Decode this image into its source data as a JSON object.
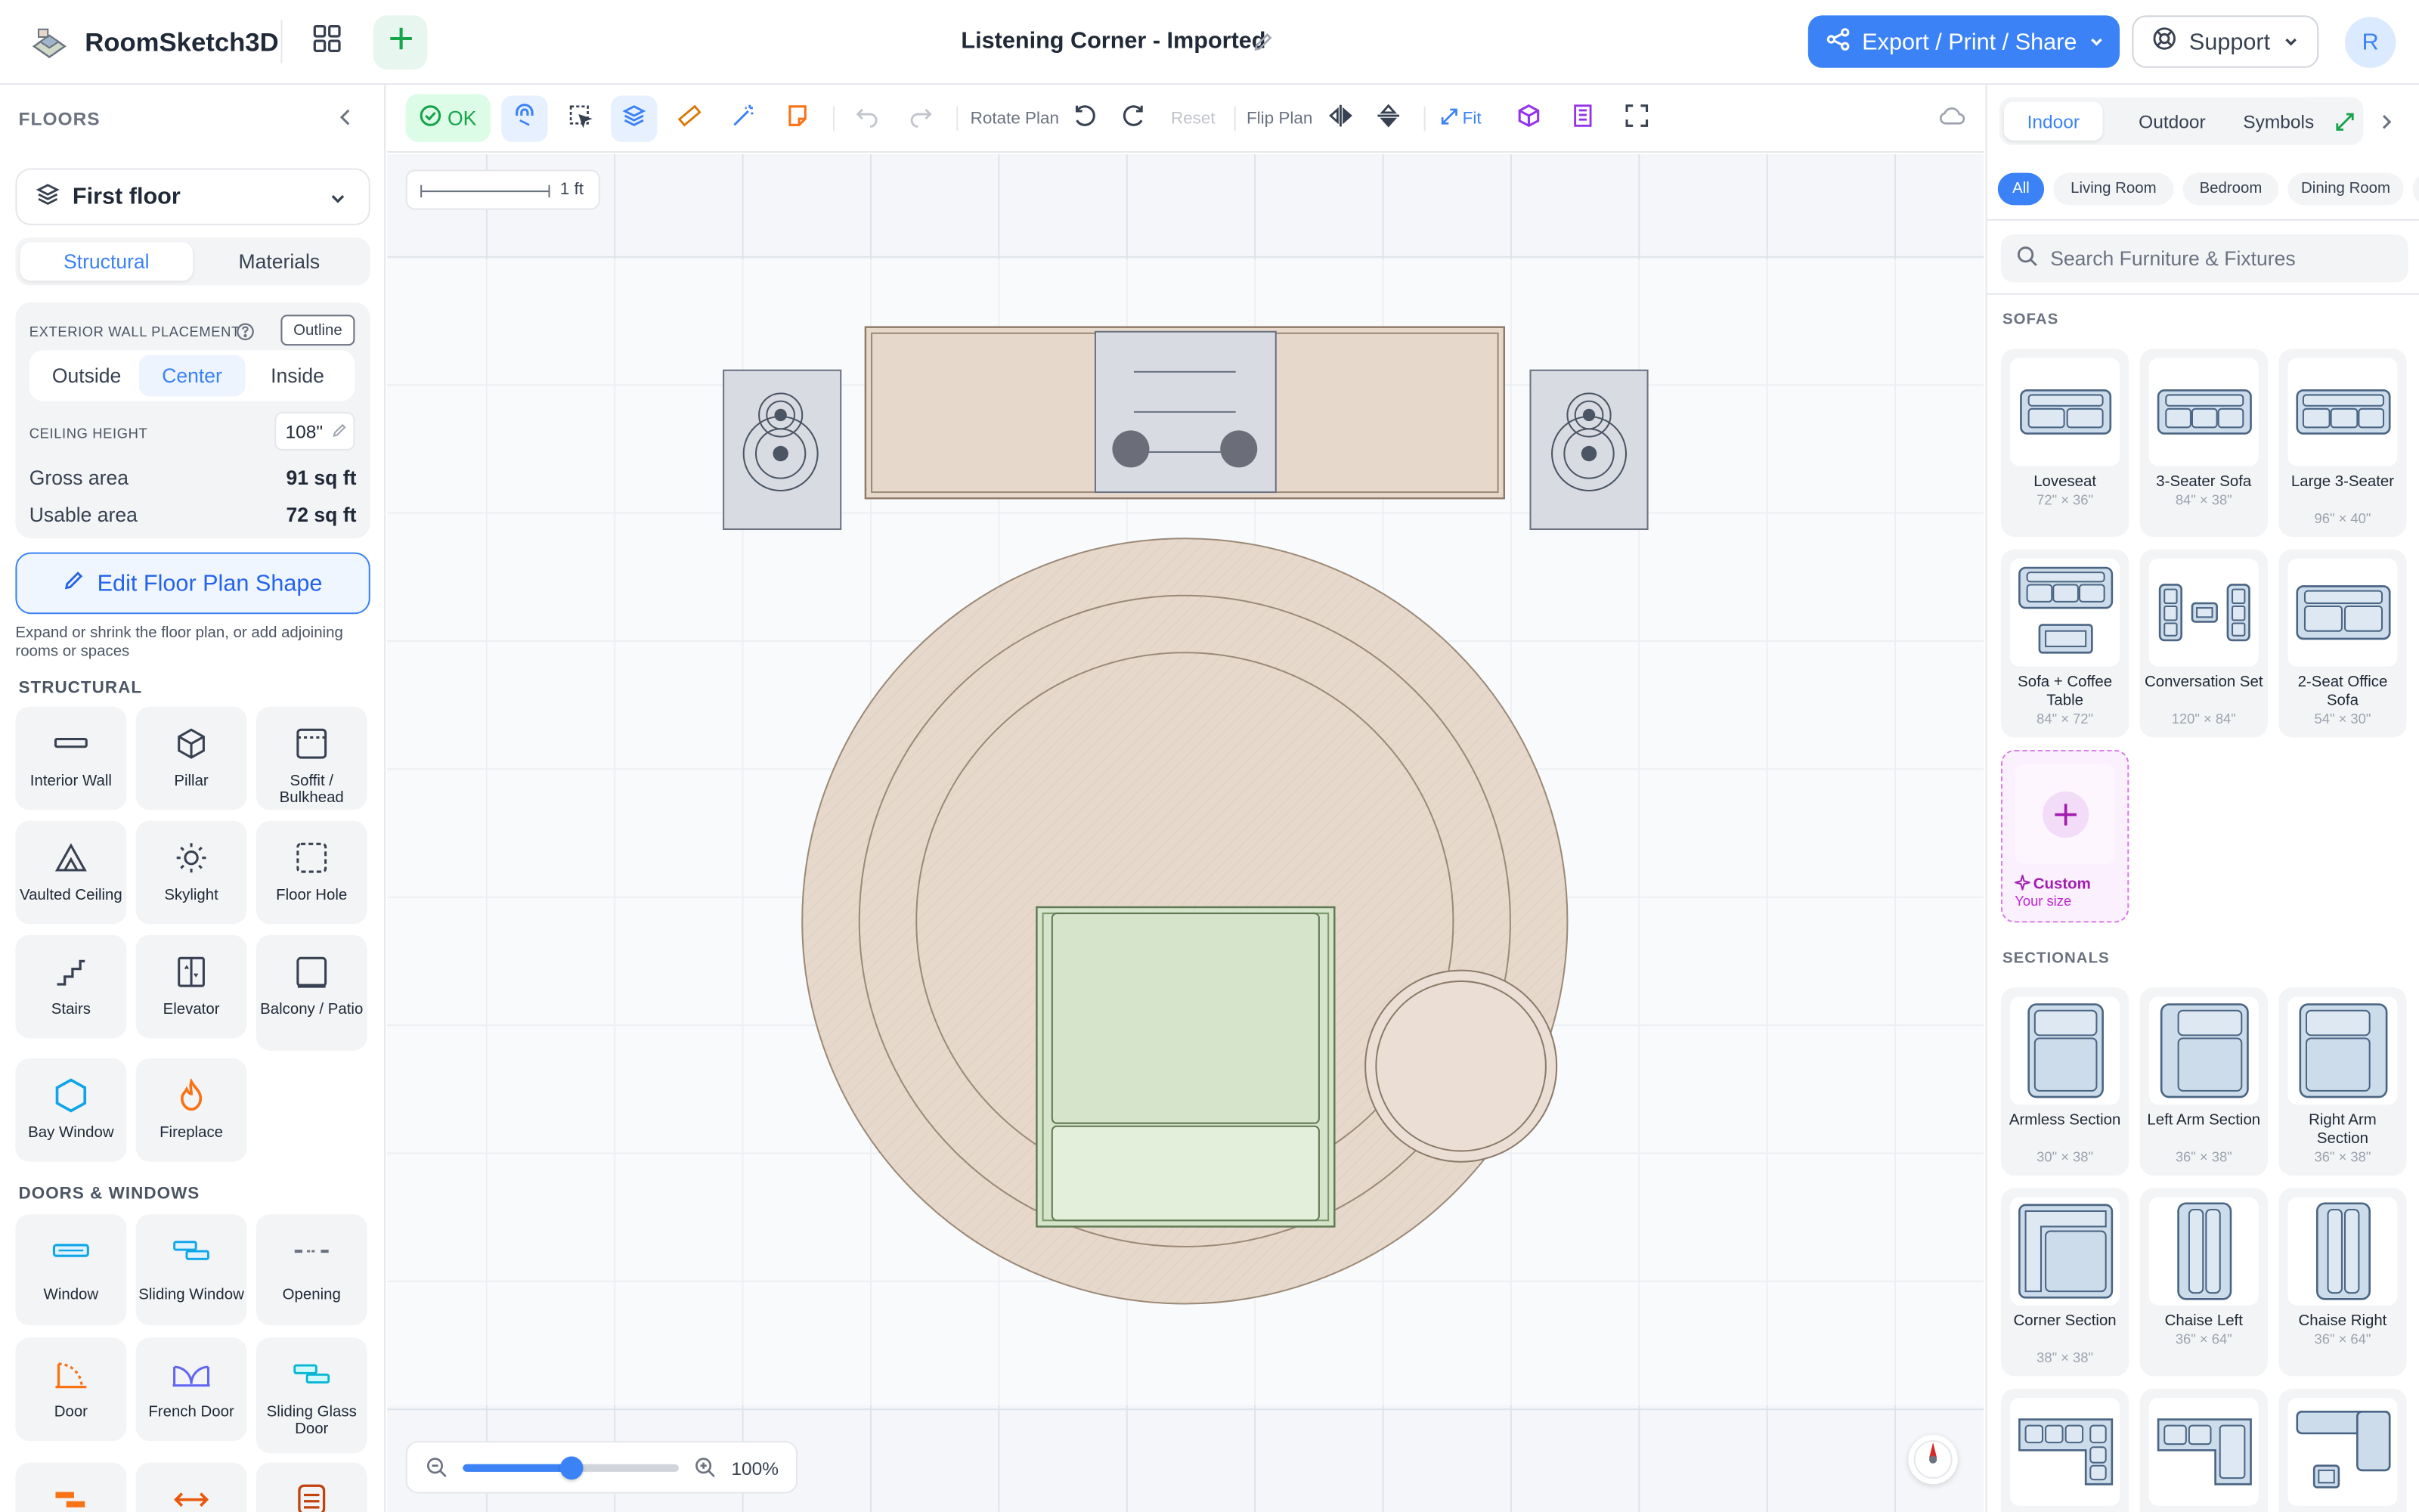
{
  "app": {
    "name": "RoomSketch3D",
    "project_title": "Listening Corner - Imported",
    "export_label": "Export / Print / Share",
    "support_label": "Support",
    "avatar_initial": "R"
  },
  "left": {
    "header": "FLOORS",
    "floor": "First floor",
    "mode_tabs": [
      "Structural",
      "Materials"
    ],
    "wall_placement_label": "EXTERIOR WALL PLACEMENT",
    "outline_label": "Outline",
    "placement_options": [
      "Outside",
      "Center",
      "Inside"
    ],
    "ceiling_label": "CEILING HEIGHT",
    "ceiling_value": "108\"",
    "gross_label": "Gross area",
    "gross_value": "91 sq ft",
    "usable_label": "Usable area",
    "usable_value": "72 sq ft",
    "edit_button": "Edit Floor Plan Shape",
    "edit_hint": "Expand or shrink the floor plan, or add adjoining rooms or spaces",
    "structural_header": "STRUCTURAL",
    "structural": [
      "Interior Wall",
      "Pillar",
      "Soffit / Bulkhead",
      "Vaulted Ceiling",
      "Skylight",
      "Floor Hole",
      "Stairs",
      "Elevator",
      "Balcony / Patio",
      "Bay Window",
      "Fireplace"
    ],
    "doors_header": "DOORS & WINDOWS",
    "doors": [
      "Window",
      "Sliding Window",
      "Opening",
      "Door",
      "French Door",
      "Sliding Glass Door",
      "",
      "",
      ""
    ]
  },
  "toolbar": {
    "ok": "OK",
    "rotate": "Rotate Plan",
    "reset": "Reset",
    "flip": "Flip Plan",
    "fit": "Fit"
  },
  "canvas": {
    "scale_label": "1 ft",
    "zoom_percent": "100%",
    "zoom_value": 0.5
  },
  "right": {
    "tabs": [
      "Indoor",
      "Outdoor",
      "Symbols"
    ],
    "chips": [
      "All",
      "Living Room",
      "Bedroom",
      "Dining Room"
    ],
    "search_placeholder": "Search Furniture & Fixtures",
    "sofas_header": "SOFAS",
    "sofas": [
      {
        "name": "Loveseat",
        "size": "72\" × 36\""
      },
      {
        "name": "3-Seater Sofa",
        "size": "84\" × 38\""
      },
      {
        "name": "Large 3-Seater",
        "size": "96\" × 40\""
      },
      {
        "name": "Sofa + Coffee Table",
        "size": "84\" × 72\""
      },
      {
        "name": "Conversation Set",
        "size": "120\" × 84\""
      },
      {
        "name": "2-Seat Office Sofa",
        "size": "54\" × 30\""
      }
    ],
    "custom_name": "Custom",
    "custom_sub": "Your size",
    "sectionals_header": "SECTIONALS",
    "sectionals": [
      {
        "name": "Armless Section",
        "size": "30\" × 38\""
      },
      {
        "name": "Left Arm Section",
        "size": "36\" × 38\""
      },
      {
        "name": "Right Arm Section",
        "size": "36\" × 38\""
      },
      {
        "name": "Corner Section",
        "size": "38\" × 38\""
      },
      {
        "name": "Chaise Left",
        "size": "36\" × 64\""
      },
      {
        "name": "Chaise Right",
        "size": "36\" × 64\""
      }
    ]
  },
  "colors": {
    "accent": "#3b82f6",
    "ok": "#16a34a",
    "furniture": "#e6d9cc",
    "chair": "#d6e4cb",
    "speaker": "#d9dbe3"
  }
}
